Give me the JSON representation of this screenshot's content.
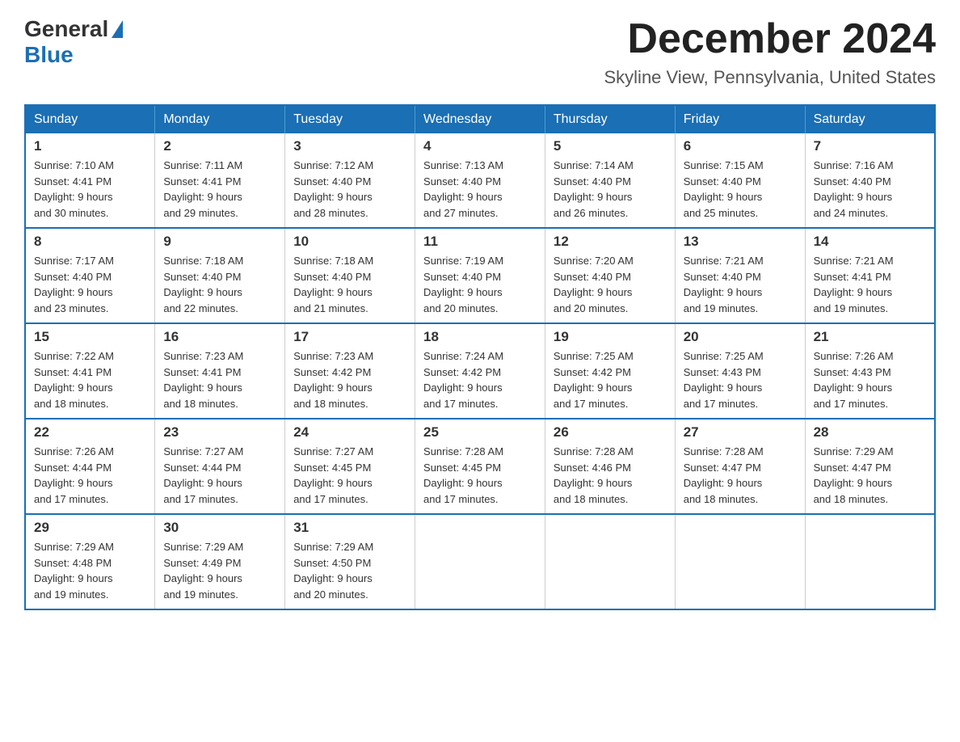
{
  "header": {
    "logo_general": "General",
    "logo_blue": "Blue",
    "month_title": "December 2024",
    "location": "Skyline View, Pennsylvania, United States"
  },
  "weekdays": [
    "Sunday",
    "Monday",
    "Tuesday",
    "Wednesday",
    "Thursday",
    "Friday",
    "Saturday"
  ],
  "weeks": [
    [
      {
        "day": "1",
        "sunrise": "7:10 AM",
        "sunset": "4:41 PM",
        "daylight": "9 hours and 30 minutes."
      },
      {
        "day": "2",
        "sunrise": "7:11 AM",
        "sunset": "4:41 PM",
        "daylight": "9 hours and 29 minutes."
      },
      {
        "day": "3",
        "sunrise": "7:12 AM",
        "sunset": "4:40 PM",
        "daylight": "9 hours and 28 minutes."
      },
      {
        "day": "4",
        "sunrise": "7:13 AM",
        "sunset": "4:40 PM",
        "daylight": "9 hours and 27 minutes."
      },
      {
        "day": "5",
        "sunrise": "7:14 AM",
        "sunset": "4:40 PM",
        "daylight": "9 hours and 26 minutes."
      },
      {
        "day": "6",
        "sunrise": "7:15 AM",
        "sunset": "4:40 PM",
        "daylight": "9 hours and 25 minutes."
      },
      {
        "day": "7",
        "sunrise": "7:16 AM",
        "sunset": "4:40 PM",
        "daylight": "9 hours and 24 minutes."
      }
    ],
    [
      {
        "day": "8",
        "sunrise": "7:17 AM",
        "sunset": "4:40 PM",
        "daylight": "9 hours and 23 minutes."
      },
      {
        "day": "9",
        "sunrise": "7:18 AM",
        "sunset": "4:40 PM",
        "daylight": "9 hours and 22 minutes."
      },
      {
        "day": "10",
        "sunrise": "7:18 AM",
        "sunset": "4:40 PM",
        "daylight": "9 hours and 21 minutes."
      },
      {
        "day": "11",
        "sunrise": "7:19 AM",
        "sunset": "4:40 PM",
        "daylight": "9 hours and 20 minutes."
      },
      {
        "day": "12",
        "sunrise": "7:20 AM",
        "sunset": "4:40 PM",
        "daylight": "9 hours and 20 minutes."
      },
      {
        "day": "13",
        "sunrise": "7:21 AM",
        "sunset": "4:40 PM",
        "daylight": "9 hours and 19 minutes."
      },
      {
        "day": "14",
        "sunrise": "7:21 AM",
        "sunset": "4:41 PM",
        "daylight": "9 hours and 19 minutes."
      }
    ],
    [
      {
        "day": "15",
        "sunrise": "7:22 AM",
        "sunset": "4:41 PM",
        "daylight": "9 hours and 18 minutes."
      },
      {
        "day": "16",
        "sunrise": "7:23 AM",
        "sunset": "4:41 PM",
        "daylight": "9 hours and 18 minutes."
      },
      {
        "day": "17",
        "sunrise": "7:23 AM",
        "sunset": "4:42 PM",
        "daylight": "9 hours and 18 minutes."
      },
      {
        "day": "18",
        "sunrise": "7:24 AM",
        "sunset": "4:42 PM",
        "daylight": "9 hours and 17 minutes."
      },
      {
        "day": "19",
        "sunrise": "7:25 AM",
        "sunset": "4:42 PM",
        "daylight": "9 hours and 17 minutes."
      },
      {
        "day": "20",
        "sunrise": "7:25 AM",
        "sunset": "4:43 PM",
        "daylight": "9 hours and 17 minutes."
      },
      {
        "day": "21",
        "sunrise": "7:26 AM",
        "sunset": "4:43 PM",
        "daylight": "9 hours and 17 minutes."
      }
    ],
    [
      {
        "day": "22",
        "sunrise": "7:26 AM",
        "sunset": "4:44 PM",
        "daylight": "9 hours and 17 minutes."
      },
      {
        "day": "23",
        "sunrise": "7:27 AM",
        "sunset": "4:44 PM",
        "daylight": "9 hours and 17 minutes."
      },
      {
        "day": "24",
        "sunrise": "7:27 AM",
        "sunset": "4:45 PM",
        "daylight": "9 hours and 17 minutes."
      },
      {
        "day": "25",
        "sunrise": "7:28 AM",
        "sunset": "4:45 PM",
        "daylight": "9 hours and 17 minutes."
      },
      {
        "day": "26",
        "sunrise": "7:28 AM",
        "sunset": "4:46 PM",
        "daylight": "9 hours and 18 minutes."
      },
      {
        "day": "27",
        "sunrise": "7:28 AM",
        "sunset": "4:47 PM",
        "daylight": "9 hours and 18 minutes."
      },
      {
        "day": "28",
        "sunrise": "7:29 AM",
        "sunset": "4:47 PM",
        "daylight": "9 hours and 18 minutes."
      }
    ],
    [
      {
        "day": "29",
        "sunrise": "7:29 AM",
        "sunset": "4:48 PM",
        "daylight": "9 hours and 19 minutes."
      },
      {
        "day": "30",
        "sunrise": "7:29 AM",
        "sunset": "4:49 PM",
        "daylight": "9 hours and 19 minutes."
      },
      {
        "day": "31",
        "sunrise": "7:29 AM",
        "sunset": "4:50 PM",
        "daylight": "9 hours and 20 minutes."
      },
      null,
      null,
      null,
      null
    ]
  ],
  "labels": {
    "sunrise": "Sunrise:",
    "sunset": "Sunset:",
    "daylight": "Daylight:"
  }
}
